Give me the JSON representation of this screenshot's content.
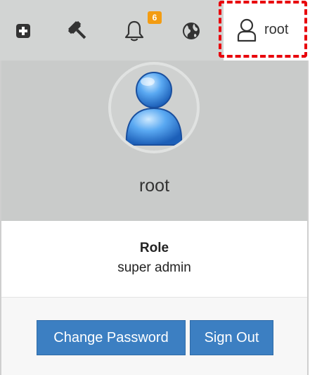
{
  "navbar": {
    "icons": [
      "plus-square-icon",
      "gavel-icon",
      "bell-icon",
      "globe-icon",
      "user-icon"
    ],
    "notification_count": "6",
    "user_name": "root"
  },
  "user_panel": {
    "name": "root",
    "role_label": "Role",
    "role_value": "super admin",
    "change_password_label": "Change Password",
    "sign_out_label": "Sign Out"
  },
  "colors": {
    "navbar_bg": "#d2d4d3",
    "header_bg": "#c9cbca",
    "button_bg": "#3c7fc2",
    "badge_bg": "#f39c12",
    "highlight": "#e8000b"
  }
}
